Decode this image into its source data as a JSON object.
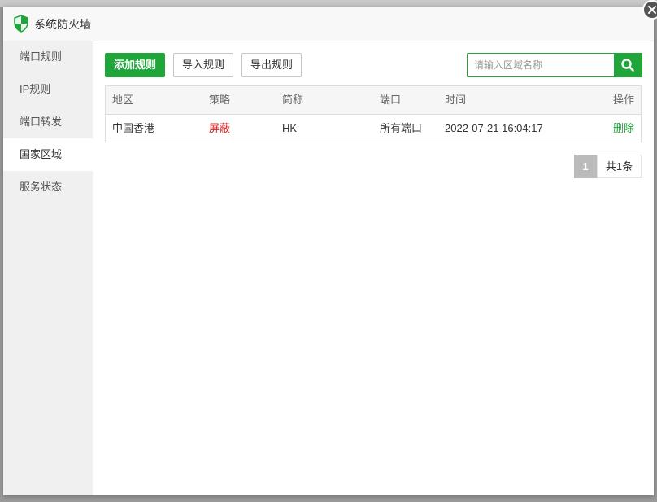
{
  "window": {
    "title": "系统防火墙"
  },
  "sidebar": {
    "items": [
      {
        "label": "端口规则",
        "active": false
      },
      {
        "label": "IP规则",
        "active": false
      },
      {
        "label": "端口转发",
        "active": false
      },
      {
        "label": "国家区域",
        "active": true
      },
      {
        "label": "服务状态",
        "active": false
      }
    ]
  },
  "toolbar": {
    "add_label": "添加规则",
    "import_label": "导入规则",
    "export_label": "导出规则"
  },
  "search": {
    "placeholder": "请输入区域名称",
    "value": ""
  },
  "table": {
    "headers": [
      "地区",
      "策略",
      "简称",
      "端口",
      "时间",
      "操作"
    ],
    "rows": [
      {
        "region": "中国香港",
        "policy": "屏蔽",
        "abbr": "HK",
        "port": "所有端口",
        "time": "2022-07-21 16:04:17",
        "action": "删除"
      }
    ]
  },
  "pagination": {
    "current": "1",
    "total": "共1条"
  },
  "colors": {
    "accent": "#20a53a",
    "blocked": "#e01e1e"
  },
  "icons": {
    "title": "shield-icon",
    "close": "close-icon",
    "search": "search-icon"
  }
}
